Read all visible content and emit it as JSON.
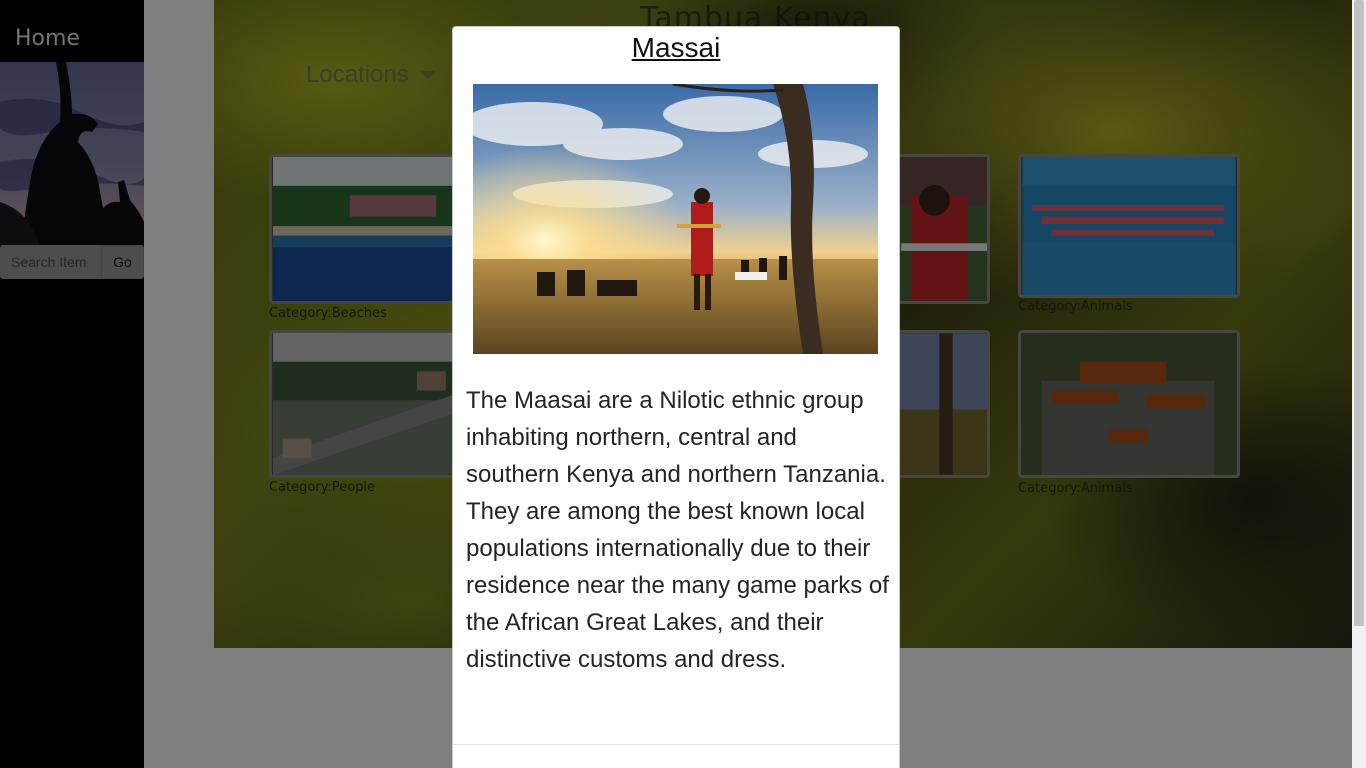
{
  "sidebar": {
    "home_label": "Home",
    "search": {
      "placeholder": "Search Item",
      "value": ""
    },
    "go_label": "Go"
  },
  "header": {
    "brand": "Tambua Kenya",
    "locations_label": "Locations"
  },
  "gallery": {
    "cards": [
      {
        "caption": "Category:Beaches",
        "image": "beach-resort-photo"
      },
      {
        "caption": "",
        "image": "football-players-photo"
      },
      {
        "caption": "Category:Animals",
        "image": "flamingos-lake-photo"
      },
      {
        "caption": "Category:People",
        "image": "city-highway-photo"
      },
      {
        "caption": "",
        "image": "massai-savanna-photo"
      },
      {
        "caption": "Category:Animals",
        "image": "park-gate-sign-photo"
      }
    ]
  },
  "modal": {
    "title": "Massai",
    "image": "massai-savanna-photo",
    "description": "The Maasai are a Nilotic ethnic group inhabiting northern, central and southern Kenya and northern Tanzania. They are among the best known local populations internationally due to their residence near the many game parks of the African Great Lakes, and their distinctive customs and dress."
  },
  "colors": {
    "sidebar_bg": "#000000",
    "backdrop": "rgba(0,0,0,0.5)",
    "modal_bg": "#ffffff"
  }
}
